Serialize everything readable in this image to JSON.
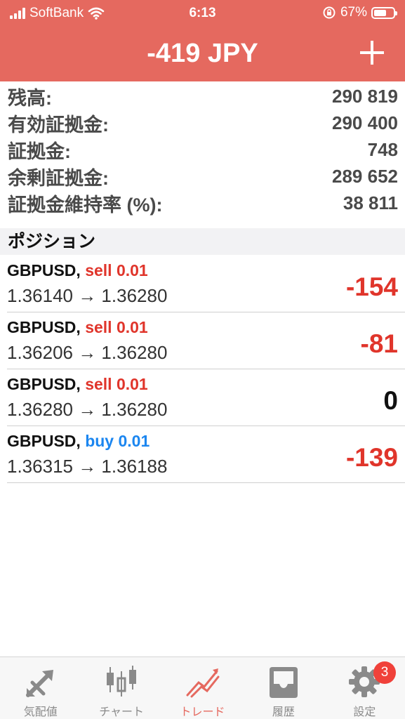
{
  "status_bar": {
    "carrier": "SoftBank",
    "time": "6:13",
    "battery_percent": "67%",
    "battery_level": 0.67
  },
  "header": {
    "title": "-419 JPY",
    "add_icon": "plus-icon"
  },
  "summary": [
    {
      "label": "残高:",
      "value": "290 819"
    },
    {
      "label": "有効証拠金:",
      "value": "290 400"
    },
    {
      "label": "証拠金:",
      "value": "748"
    },
    {
      "label": "余剰証拠金:",
      "value": "289 652"
    },
    {
      "label": "証拠金維持率 (%):",
      "value": "38 811"
    }
  ],
  "positions_section": {
    "title": "ポジション"
  },
  "positions": [
    {
      "symbol": "GBPUSD,",
      "side": "sell 0.01",
      "side_type": "sell",
      "prices": "1.36140 → 1.36280",
      "profit": "-154"
    },
    {
      "symbol": "GBPUSD,",
      "side": "sell 0.01",
      "side_type": "sell",
      "prices": "1.36206 → 1.36280",
      "profit": "-81"
    },
    {
      "symbol": "GBPUSD,",
      "side": "sell 0.01",
      "side_type": "sell",
      "prices": "1.36280 → 1.36280",
      "profit": "0"
    },
    {
      "symbol": "GBPUSD,",
      "side": "buy 0.01",
      "side_type": "buy",
      "prices": "1.36315 → 1.36188",
      "profit": "-139"
    }
  ],
  "tabs": [
    {
      "label": "気配値",
      "icon": "quotes-arrows-icon"
    },
    {
      "label": "チャート",
      "icon": "candlestick-chart-icon"
    },
    {
      "label": "トレード",
      "icon": "trade-trend-icon",
      "active": true
    },
    {
      "label": "履歴",
      "icon": "inbox-history-icon"
    },
    {
      "label": "設定",
      "icon": "gear-icon"
    }
  ],
  "settings_badge": "3",
  "colors": {
    "header": "#e5695f",
    "loss": "#e0352b",
    "buy": "#1b86f0",
    "active_tab": "#e5695f",
    "badge": "#f0413a"
  }
}
